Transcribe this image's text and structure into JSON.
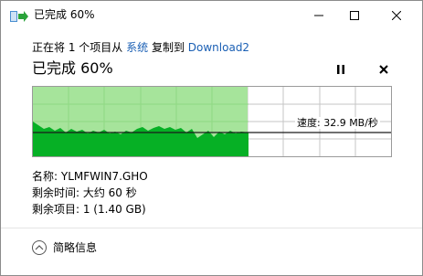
{
  "window": {
    "title": "已完成 60%"
  },
  "copy_status": {
    "prefix": "正在将 1 个项目从",
    "source": "系统",
    "middle": "复制到",
    "destination": "Download2"
  },
  "progress": {
    "title": "已完成 60%",
    "fraction": 0.6,
    "speed_label": "速度: 32.9 MB/秒"
  },
  "details": {
    "name": "名称: YLMFWIN7.GHO",
    "time_left": "剩余时间: 大约 60 秒",
    "items_left": "剩余项目: 1 (1.40 GB)"
  },
  "footer": {
    "toggle_label": "简略信息"
  },
  "colors": {
    "accent_fill": "#06b025",
    "progress_bg": "#a6e49b",
    "link": "#1a5fb4"
  },
  "icons": {
    "app": "copy-arrow-icon",
    "minimize": "minimize-icon",
    "maximize": "maximize-icon",
    "close": "close-icon",
    "pause": "pause-icon",
    "cancel": "cancel-icon",
    "toggle": "chevron-up-icon"
  }
}
